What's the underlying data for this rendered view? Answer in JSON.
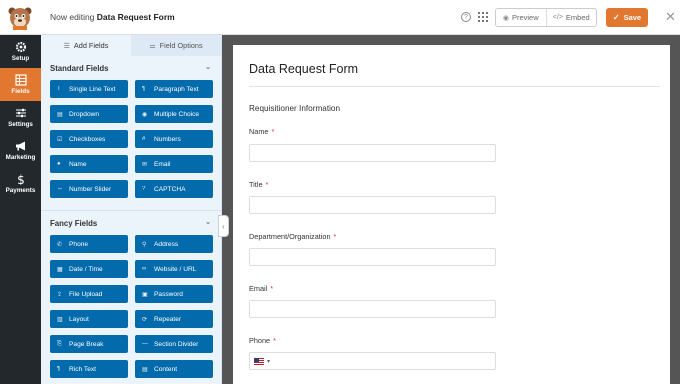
{
  "header": {
    "editing_prefix": "Now editing",
    "form_name": "Data Request Form",
    "help_icon": "help-circle-icon",
    "apps_icon": "grid-icon",
    "preview_label": "Preview",
    "embed_label": "Embed",
    "save_label": "Save",
    "close_icon": "close-icon"
  },
  "nav": {
    "items": [
      {
        "label": "Setup",
        "icon": "gear-icon"
      },
      {
        "label": "Fields",
        "icon": "fields-icon"
      },
      {
        "label": "Settings",
        "icon": "sliders-icon"
      },
      {
        "label": "Marketing",
        "icon": "megaphone-icon"
      },
      {
        "label": "Payments",
        "icon": "dollar-icon"
      }
    ]
  },
  "panel": {
    "tabs": [
      {
        "label": "Add Fields",
        "icon": "list-icon"
      },
      {
        "label": "Field Options",
        "icon": "sliders-icon"
      }
    ],
    "standard": {
      "title": "Standard Fields",
      "fields": [
        {
          "label": "Single Line Text",
          "icon": "T"
        },
        {
          "label": "Paragraph Text",
          "icon": "¶"
        },
        {
          "label": "Dropdown",
          "icon": "▤"
        },
        {
          "label": "Multiple Choice",
          "icon": "◉"
        },
        {
          "label": "Checkboxes",
          "icon": "☑"
        },
        {
          "label": "Numbers",
          "icon": "#"
        },
        {
          "label": "Name",
          "icon": "●"
        },
        {
          "label": "Email",
          "icon": "✉"
        },
        {
          "label": "Number Slider",
          "icon": "⇔"
        },
        {
          "label": "CAPTCHA",
          "icon": "?"
        }
      ]
    },
    "fancy": {
      "title": "Fancy Fields",
      "fields": [
        {
          "label": "Phone",
          "icon": "✆"
        },
        {
          "label": "Address",
          "icon": "⚲"
        },
        {
          "label": "Date / Time",
          "icon": "▦"
        },
        {
          "label": "Website / URL",
          "icon": "∞"
        },
        {
          "label": "File Upload",
          "icon": "⇪"
        },
        {
          "label": "Password",
          "icon": "▣"
        },
        {
          "label": "Layout",
          "icon": "▥"
        },
        {
          "label": "Repeater",
          "icon": "⟳"
        },
        {
          "label": "Page Break",
          "icon": "⎘"
        },
        {
          "label": "Section Divider",
          "icon": "—"
        },
        {
          "label": "Rich Text",
          "icon": "¶"
        },
        {
          "label": "Content",
          "icon": "▤"
        }
      ]
    }
  },
  "form": {
    "title": "Data Request Form",
    "section": "Requisitioner Information",
    "fields": [
      {
        "label": "Name",
        "required": "*"
      },
      {
        "label": "Title",
        "required": "*"
      },
      {
        "label": "Department/Organization",
        "required": "*"
      },
      {
        "label": "Email",
        "required": "*"
      },
      {
        "label": "Phone",
        "required": "*"
      }
    ]
  },
  "colors": {
    "accent": "#e27730",
    "field_button": "#036aab",
    "nav_bg": "#23282d",
    "required": "#d63638"
  }
}
